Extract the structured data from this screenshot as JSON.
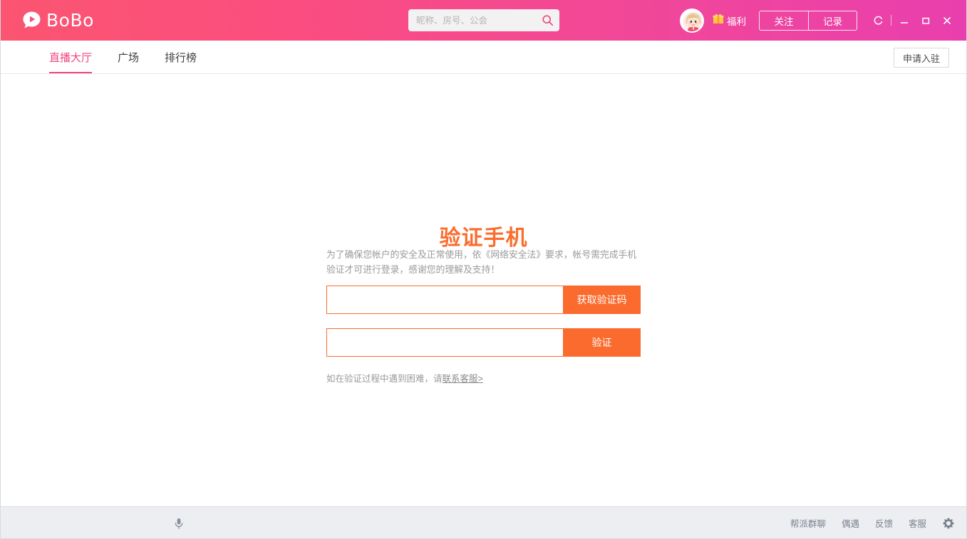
{
  "titlebar": {
    "brand_name": "BoBo",
    "brand_icon": "play-bubble-logo-icon",
    "search": {
      "placeholder": "昵称、房号、公会",
      "value": "",
      "icon": "search-icon"
    },
    "avatar_icon": "user-avatar",
    "welfare": {
      "icon": "gift-icon",
      "label": "福利"
    },
    "buttons": [
      {
        "label": "关注",
        "name": "follow-button"
      },
      {
        "label": "记录",
        "name": "history-button"
      }
    ],
    "window_controls": [
      {
        "name": "refresh-button",
        "icon": "refresh-icon",
        "glyph": "C"
      },
      {
        "name": "minimize-button",
        "icon": "minimize-icon",
        "glyph": "_"
      },
      {
        "name": "maximize-button",
        "icon": "maximize-icon",
        "glyph": "□"
      },
      {
        "name": "close-button",
        "icon": "close-icon",
        "glyph": "✕"
      }
    ],
    "colors": {
      "gradient_start": "#fb5571",
      "gradient_end": "#e93fae",
      "accent_pink": "#f2457c"
    }
  },
  "navbar": {
    "tabs": [
      {
        "label": "直播大厅",
        "active": true
      },
      {
        "label": "广场",
        "active": false
      },
      {
        "label": "排行榜",
        "active": false
      }
    ],
    "apply_button": "申请入驻"
  },
  "main": {
    "title": "验证手机",
    "title_color": "#fa6d2e",
    "description": "为了确保您帐户的安全及正常使用，依《网络安全法》要求，帐号需完成手机验证才可进行登录，感谢您的理解及支持！",
    "phone_field": {
      "value": "",
      "placeholder": "",
      "button_label": "获取验证码"
    },
    "code_field": {
      "value": "",
      "placeholder": "",
      "button_label": "验证"
    },
    "help_text": "如在验证过程中遇到困难，请",
    "help_link": "联系客服>",
    "button_color": "#fa6b2d"
  },
  "footer": {
    "mic_icon": "microphone-icon",
    "links": [
      {
        "label": "帮派群聊"
      },
      {
        "label": "偶遇"
      },
      {
        "label": "反馈"
      },
      {
        "label": "客服"
      }
    ],
    "settings_icon": "gear-icon"
  }
}
